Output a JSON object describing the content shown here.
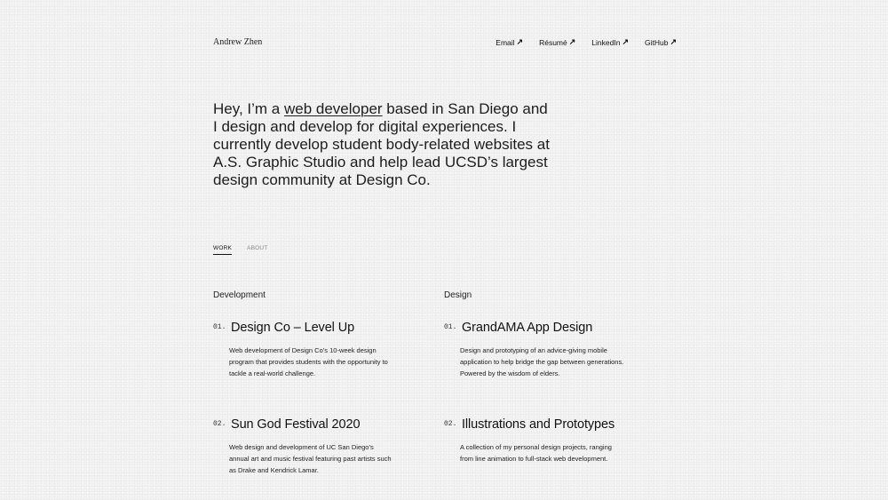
{
  "header": {
    "name": "Andrew Zhen",
    "nav": [
      {
        "label": "Email",
        "icon": "arrow-up-right-icon"
      },
      {
        "label": "Résumé",
        "icon": "arrow-up-right-icon"
      },
      {
        "label": "LinkedIn",
        "icon": "arrow-up-right-icon"
      },
      {
        "label": "GitHub",
        "icon": "arrow-up-right-icon"
      }
    ]
  },
  "hero": {
    "prefix": "Hey, I’m a ",
    "highlight": "web developer",
    "suffix": " based in San Diego and I design and develop for digital experiences. I currently develop student body-related websites at A.S. Graphic Studio and help lead UCSD’s largest design community at Design Co."
  },
  "tabs": [
    {
      "label": "WORK",
      "active": true
    },
    {
      "label": "ABOUT",
      "active": false
    }
  ],
  "development": {
    "title": "Development",
    "projects": [
      {
        "num": "01.",
        "title": "Design Co – Level Up",
        "desc": "Web development of Design Co’s 10-week design program that provides students with the opportunity to tackle a real-world challenge."
      },
      {
        "num": "02.",
        "title": "Sun God Festival 2020",
        "desc": "Web design and development of UC San Diego’s annual art and music festival featuring past artists such as Drake and Kendrick Lamar."
      }
    ]
  },
  "design": {
    "title": "Design",
    "projects": [
      {
        "num": "01.",
        "title": "GrandAMA App Design",
        "desc": "Design and prototyping of an advice-giving mobile application to help bridge the gap between generations. Powered by the wisdom of elders."
      },
      {
        "num": "02.",
        "title": "Illustrations and Prototypes",
        "desc": "A collection of my personal design projects, ranging from line animation to full-stack web development."
      }
    ]
  },
  "colors": {
    "background": "#f3f3f3",
    "text": "#1a1a1a",
    "muted": "#888888"
  }
}
